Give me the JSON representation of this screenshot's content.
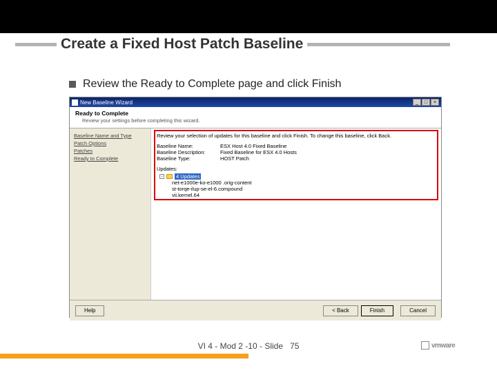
{
  "slide": {
    "title": "Create a Fixed Host Patch Baseline",
    "bullet": "Review the Ready to Complete page and click Finish",
    "footer": "VI 4 - Mod 2 -10 - Slide",
    "page_num": "75",
    "logo": "vmware"
  },
  "dialog": {
    "title": "New Baseline Wizard",
    "header": "Ready to Complete",
    "header_sub": "Review your settings before completing this wizard.",
    "nav": [
      "Baseline Name and Type",
      "Patch Options",
      "Patches",
      "Ready to Complete"
    ],
    "content": {
      "instr": "Review your selection of updates for this baseline and click Finish. To change this baseline, click Back.",
      "rows": [
        {
          "label": "Baseline Name:",
          "value": "ESX Host 4.0 Fixed Baseline"
        },
        {
          "label": "Baseline Description:",
          "value": "Fixed Baseline for ESX 4.0 Hosts"
        },
        {
          "label": "Baseline Type:",
          "value": "HOST Patch"
        }
      ],
      "updates_label": "Updates:",
      "tree_root": "4 Updates",
      "tree_children": [
        "net-e1000e-ko-e1000 .orig-content",
        "st-torqe-ilup-se-el-6.compound",
        "vii.kernel.64"
      ]
    },
    "buttons": {
      "help": "Help",
      "back": "< Back",
      "finish": "Finish",
      "cancel": "Cancel"
    }
  }
}
